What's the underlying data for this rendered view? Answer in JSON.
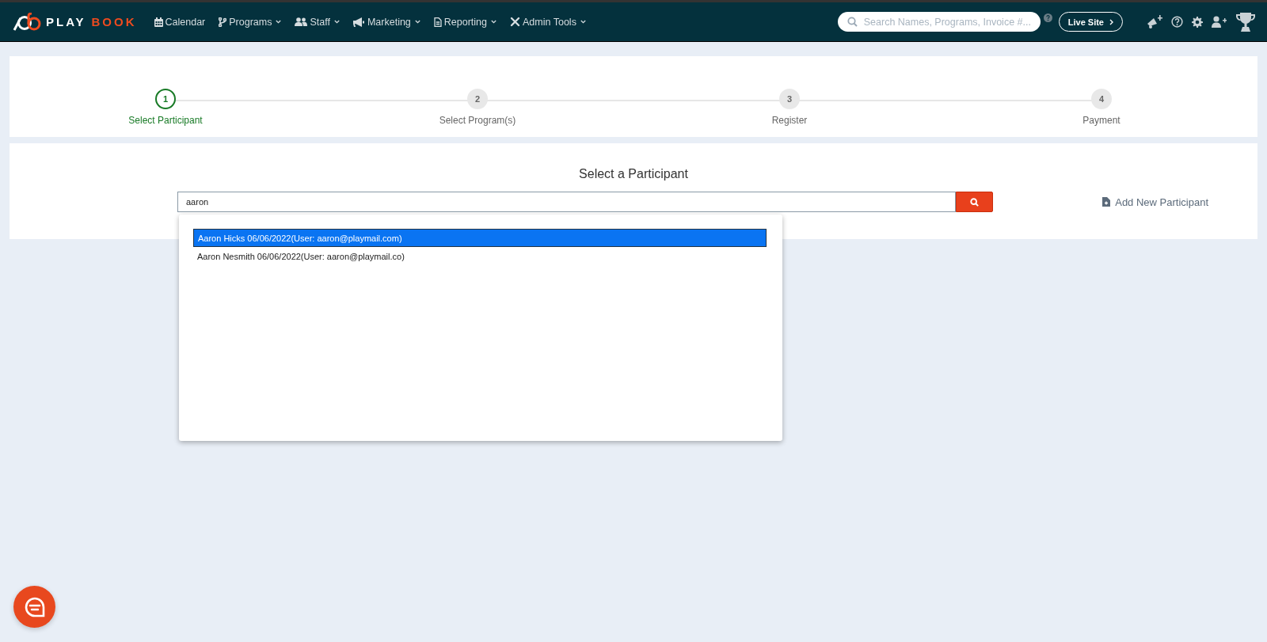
{
  "navbar": {
    "logo": {
      "text_1": "PLAY",
      "text_2": "BOOK"
    },
    "menu": [
      {
        "label": "Calendar",
        "dropdown": false
      },
      {
        "label": "Programs",
        "dropdown": true
      },
      {
        "label": "Staff",
        "dropdown": true
      },
      {
        "label": "Marketing",
        "dropdown": true
      },
      {
        "label": "Reporting",
        "dropdown": true
      },
      {
        "label": "Admin Tools",
        "dropdown": true
      }
    ],
    "search": {
      "placeholder": "Search Names, Programs, Invoice #..."
    },
    "live_site_button": "Live Site"
  },
  "stepper": [
    {
      "number": "1",
      "label": "Select Participant",
      "selected": true
    },
    {
      "number": "2",
      "label": "Select Program(s)",
      "selected": false
    },
    {
      "number": "3",
      "label": "Register",
      "selected": false
    },
    {
      "number": "4",
      "label": "Payment",
      "selected": false
    }
  ],
  "participant_panel": {
    "title": "Select a Participant",
    "search": {
      "value": "aaron"
    },
    "add_link": "Add New Participant",
    "suggestions": [
      {
        "text": "Aaron Hicks 06/06/2022(User: aaron@playmail.com)",
        "selected": true
      },
      {
        "text": "Aaron Nesmith 06/06/2022(User: aaron@playmail.co)",
        "selected": false
      }
    ]
  }
}
